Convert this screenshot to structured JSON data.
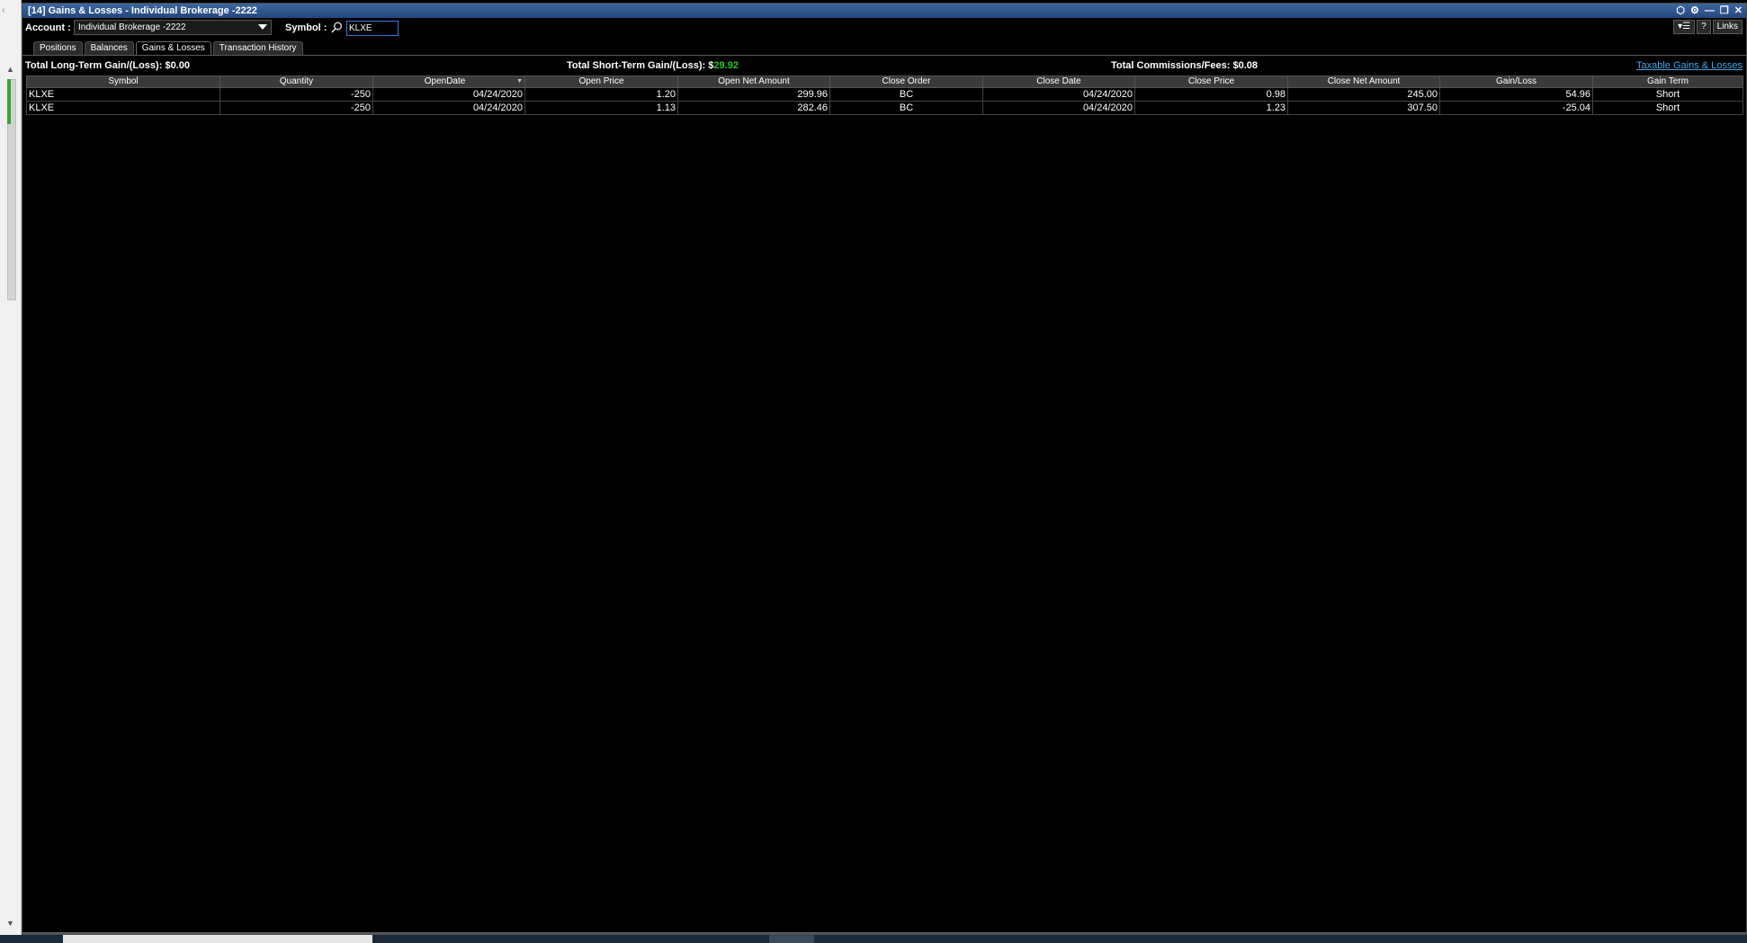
{
  "window": {
    "title": "[14] Gains & Losses - Individual Brokerage -2222",
    "controls": [
      "⬡",
      "⚙",
      "—",
      "❐",
      "✕"
    ]
  },
  "toolbar": {
    "account_label": "Account :",
    "account_value": "Individual Brokerage -2222",
    "symbol_label": "Symbol :",
    "symbol_value": "KLXE",
    "links_label": "Links",
    "help_label": "?"
  },
  "tabs": [
    "Positions",
    "Balances",
    "Gains & Losses",
    "Transaction History"
  ],
  "summary": {
    "long_term_label": "Total Long-Term Gain/(Loss):",
    "long_term_currency": "$",
    "long_term_value": "0.00",
    "short_term_label": "Total Short-Term Gain/(Loss):",
    "short_term_currency": "$",
    "short_term_value": "29.92",
    "commissions_label": "Total Commissions/Fees:",
    "commissions_currency": "$",
    "commissions_value": "0.08",
    "taxable_link": "Taxable Gains & Losses"
  },
  "table": {
    "headers": [
      "Symbol",
      "Quantity",
      "OpenDate",
      "Open Price",
      "Open Net Amount",
      "Close Order",
      "Close Date",
      "Close Price",
      "Close Net Amount",
      "Gain/Loss",
      "Gain Term"
    ],
    "rows": [
      [
        "KLXE",
        "-250",
        "04/24/2020",
        "1.20",
        "299.96",
        "BC",
        "04/24/2020",
        "0.98",
        "245.00",
        "54.96",
        "Short"
      ],
      [
        "KLXE",
        "-250",
        "04/24/2020",
        "1.13",
        "282.46",
        "BC",
        "04/24/2020",
        "1.23",
        "307.50",
        "-25.04",
        "Short"
      ]
    ]
  },
  "colors": {
    "gain": "#2ec52a",
    "loss": "#e02828",
    "link": "#4aa8e8",
    "titlebar": "#2b5390"
  }
}
